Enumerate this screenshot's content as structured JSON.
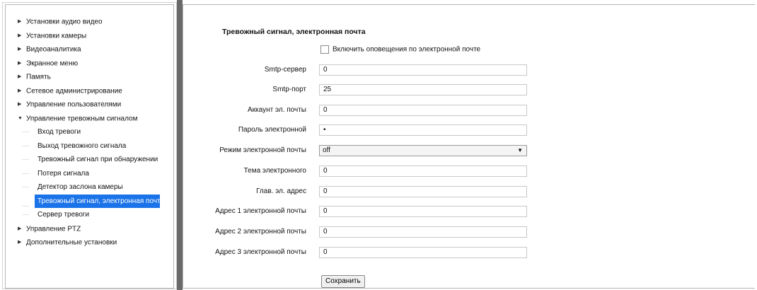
{
  "sidebar": {
    "items": [
      {
        "label": "Установки аудио видео",
        "expanded": false
      },
      {
        "label": "Установки камеры",
        "expanded": false
      },
      {
        "label": "Видеоаналитика",
        "expanded": false
      },
      {
        "label": "Экранное меню",
        "expanded": false
      },
      {
        "label": "Память",
        "expanded": false
      },
      {
        "label": "Сетевое администрирование",
        "expanded": false
      },
      {
        "label": "Управление пользователями",
        "expanded": false
      },
      {
        "label": "Управление тревожным сигналом",
        "expanded": true
      }
    ],
    "sub_items": [
      {
        "label": "Вход тревоги"
      },
      {
        "label": "Выход тревожного сигнала"
      },
      {
        "label": "Тревожный сигнал при обнаружении"
      },
      {
        "label": "Потеря сигнала"
      },
      {
        "label": "Детектор заслона камеры"
      },
      {
        "label": "Тревожный сигнал, электронная почта",
        "active": true
      },
      {
        "label": "Сервер тревоги"
      }
    ],
    "tail_items": [
      {
        "label": "Управление PTZ"
      },
      {
        "label": "Дополнительные установки"
      }
    ]
  },
  "form": {
    "title": "Тревожный сигнал, электронная почта",
    "enable_label": "Включить оповещения по электронной почте",
    "enable_checked": false,
    "fields": {
      "smtp_server": {
        "label": "Smtp-сервер",
        "value": "0"
      },
      "smtp_port": {
        "label": "Smtp-порт",
        "value": "25"
      },
      "account": {
        "label": "Аккаунт эл. почты",
        "value": "0"
      },
      "password": {
        "label": "Пароль электронной",
        "value": "•"
      },
      "mode": {
        "label": "Режим электронной почты",
        "value": "off"
      },
      "subject": {
        "label": "Тема электронного",
        "value": "0"
      },
      "main_address": {
        "label": "Глав. эл. адрес",
        "value": "0"
      },
      "address1": {
        "label": "Адрес 1 электронной почты",
        "value": "0"
      },
      "address2": {
        "label": "Адрес 2 электронной почты",
        "value": "0"
      },
      "address3": {
        "label": "Адрес 3 электронной почты",
        "value": "0"
      }
    },
    "save_label": "Сохранить"
  },
  "icons": {
    "collapsed": "triangle-right",
    "expanded": "triangle-down",
    "dropdown": "caret-down"
  },
  "colors": {
    "active_bg": "#1a73e8",
    "divider": "#6a6a6a"
  }
}
